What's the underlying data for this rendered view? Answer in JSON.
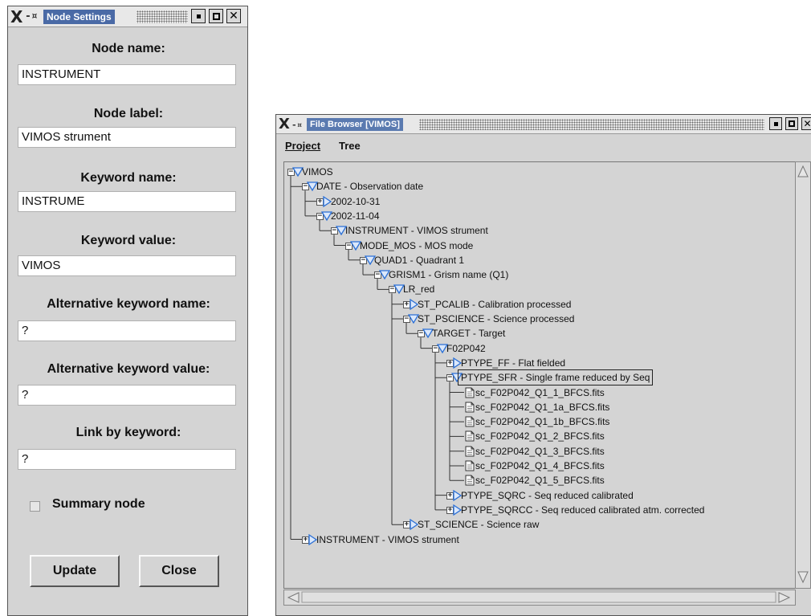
{
  "node_settings": {
    "title": "Node Settings",
    "fields": [
      {
        "label": "Node name:",
        "value": "INSTRUMENT"
      },
      {
        "label": "Node label:",
        "value": "VIMOS strument"
      },
      {
        "label": "Keyword name:",
        "value": "INSTRUME"
      },
      {
        "label": "Keyword value:",
        "value": "VIMOS"
      },
      {
        "label": "Alternative keyword name:",
        "value": "?"
      },
      {
        "label": "Alternative keyword value:",
        "value": "?"
      },
      {
        "label": "Link by keyword:",
        "value": "?"
      }
    ],
    "summary_label": "Summary node",
    "update_label": "Update",
    "close_label": "Close"
  },
  "file_browser": {
    "title": "File Browser [VIMOS]",
    "menu": [
      "Project",
      "Tree"
    ],
    "tree": [
      {
        "label": "VIMOS",
        "depth": 0,
        "kind": "open"
      },
      {
        "label": "DATE - Observation date",
        "depth": 1,
        "kind": "open"
      },
      {
        "label": "2002-10-31",
        "depth": 2,
        "kind": "closed"
      },
      {
        "label": "2002-11-04",
        "depth": 2,
        "kind": "open"
      },
      {
        "label": "INSTRUMENT - VIMOS strument",
        "depth": 3,
        "kind": "open"
      },
      {
        "label": "MODE_MOS - MOS mode",
        "depth": 4,
        "kind": "open"
      },
      {
        "label": "QUAD1 - Quadrant 1",
        "depth": 5,
        "kind": "open"
      },
      {
        "label": "GRISM1 - Grism name (Q1)",
        "depth": 6,
        "kind": "open"
      },
      {
        "label": "LR_red",
        "depth": 7,
        "kind": "open"
      },
      {
        "label": "ST_PCALIB - Calibration processed",
        "depth": 8,
        "kind": "closed"
      },
      {
        "label": "ST_PSCIENCE - Science processed",
        "depth": 8,
        "kind": "open"
      },
      {
        "label": "TARGET - Target",
        "depth": 9,
        "kind": "open"
      },
      {
        "label": "F02P042",
        "depth": 10,
        "kind": "open"
      },
      {
        "label": "PTYPE_FF - Flat fielded",
        "depth": 11,
        "kind": "closed"
      },
      {
        "label": "PTYPE_SFR - Single frame reduced by Seq",
        "depth": 11,
        "kind": "open",
        "selected": true
      },
      {
        "label": "sc_F02P042_Q1_1_BFCS.fits",
        "depth": 12,
        "kind": "file"
      },
      {
        "label": "sc_F02P042_Q1_1a_BFCS.fits",
        "depth": 12,
        "kind": "file"
      },
      {
        "label": "sc_F02P042_Q1_1b_BFCS.fits",
        "depth": 12,
        "kind": "file"
      },
      {
        "label": "sc_F02P042_Q1_2_BFCS.fits",
        "depth": 12,
        "kind": "file"
      },
      {
        "label": "sc_F02P042_Q1_3_BFCS.fits",
        "depth": 12,
        "kind": "file"
      },
      {
        "label": "sc_F02P042_Q1_4_BFCS.fits",
        "depth": 12,
        "kind": "file"
      },
      {
        "label": "sc_F02P042_Q1_5_BFCS.fits",
        "depth": 12,
        "kind": "file"
      },
      {
        "label": "PTYPE_SQRC - Seq reduced calibrated",
        "depth": 11,
        "kind": "closed"
      },
      {
        "label": "PTYPE_SQRCC - Seq reduced calibrated atm. corrected",
        "depth": 11,
        "kind": "closed"
      },
      {
        "label": "ST_SCIENCE - Science raw",
        "depth": 8,
        "kind": "closed"
      },
      {
        "label": "INSTRUMENT - VIMOS strument",
        "depth": 1,
        "kind": "closed"
      }
    ]
  },
  "icons": {
    "x_logo": "X",
    "pin": "-¤",
    "minimize": "minimize-icon",
    "maximize": "maximize-icon",
    "close": "✕"
  },
  "colors": {
    "window_bg": "#d4d4d4",
    "title_active": "#4a6aa6",
    "tree_arrow": "#2a6fd6"
  }
}
